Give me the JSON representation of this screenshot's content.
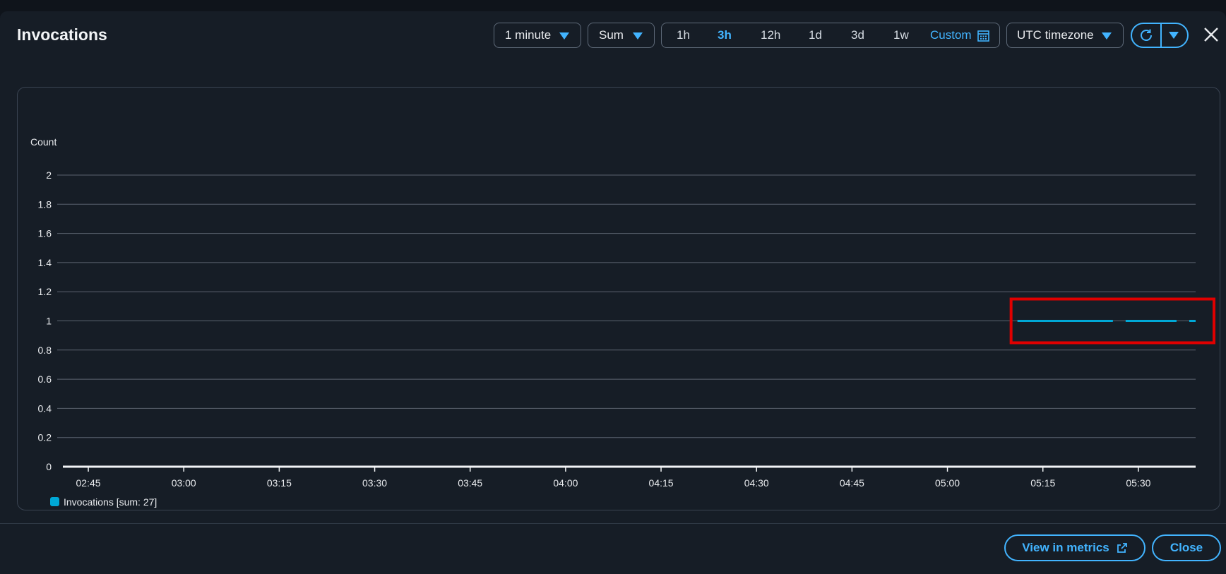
{
  "header": {
    "title": "Invocations",
    "period": "1 minute",
    "statistic": "Sum",
    "ranges": [
      "1h",
      "3h",
      "12h",
      "1d",
      "3d",
      "1w"
    ],
    "active_range": "3h",
    "custom_label": "Custom",
    "timezone": "UTC timezone"
  },
  "footer": {
    "view_metrics_label": "View in metrics",
    "close_label": "Close"
  },
  "colors": {
    "accent": "#42b4ff",
    "series": "#00a8d6",
    "highlight": "#e00000"
  },
  "chart_data": {
    "type": "line",
    "ylabel": "Count",
    "ylim": [
      0,
      2
    ],
    "yticks": [
      "0",
      "0.2",
      "0.4",
      "0.6",
      "0.8",
      "1",
      "1.2",
      "1.4",
      "1.6",
      "1.8",
      "2"
    ],
    "xticks": [
      "02:45",
      "03:00",
      "03:15",
      "03:30",
      "03:45",
      "04:00",
      "04:15",
      "04:30",
      "04:45",
      "05:00",
      "05:15",
      "05:30"
    ],
    "xlim": [
      "02:41",
      "05:39"
    ],
    "grid": true,
    "legend_position": "bottom-left",
    "series": [
      {
        "name": "Invocations [sum: 27]",
        "color": "#00a8d6",
        "segments": [
          {
            "start": "05:11",
            "end": "05:26",
            "value": 1
          },
          {
            "start": "05:28",
            "end": "05:36",
            "value": 1
          },
          {
            "start": "05:38",
            "end": "05:39",
            "value": 1
          }
        ]
      }
    ],
    "highlight_box": {
      "x_start": "05:10",
      "x_end": "05:39",
      "y_low": 0.85,
      "y_high": 1.15
    }
  }
}
